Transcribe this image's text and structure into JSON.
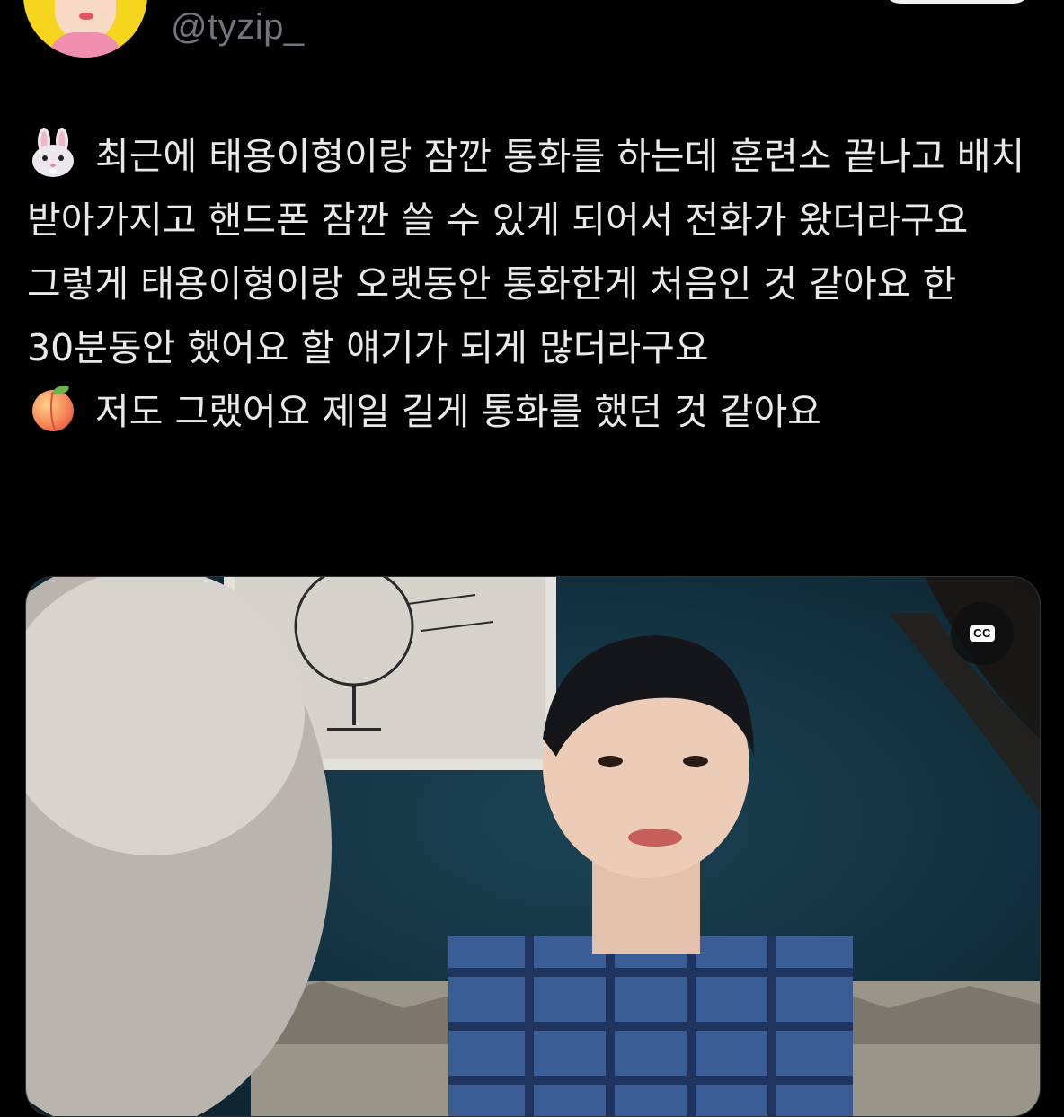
{
  "tweet": {
    "handle": "@tyzip_",
    "lines": [
      {
        "emoji": "rabbit-face-icon",
        "text": "최근에 태용이형이랑 잠깐 통화를 하는데 훈련소 끝나고 배치 받아가지고 핸드폰 잠깐 쓸 수 있게 되어서 전화가 왔더라구요 그렇게 태용이형이랑 오랫동안 통화한게 처음인 것 같아요 한 30분동안 했어요 할 얘기가 되게 많더라구요"
      },
      {
        "emoji": "peach-icon",
        "text": "저도 그랬어요 제일 길게 통화를 했던 것 같아요"
      }
    ]
  },
  "media": {
    "captions_button_label": "CC"
  },
  "colors": {
    "background": "#000000",
    "text": "#e7e9ea",
    "secondary_text": "#71767b",
    "avatar_bg": "#f5d51d"
  }
}
